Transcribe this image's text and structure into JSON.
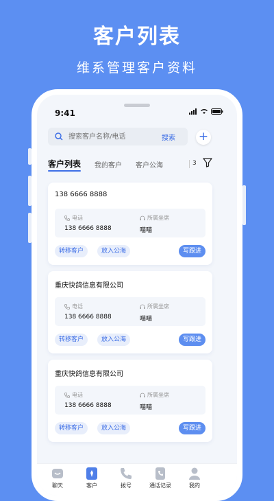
{
  "hero": {
    "title": "客户列表",
    "subtitle": "维系管理客户资料"
  },
  "status": {
    "time": "9:41"
  },
  "search": {
    "placeholder": "搜索客户名称/电话",
    "button": "搜索"
  },
  "add_label": "+",
  "tabs": [
    "客户列表",
    "我的客户",
    "客户公海"
  ],
  "tab_badge": "3",
  "labels": {
    "phone": "电话",
    "seat": "所属坐席"
  },
  "actions": {
    "transfer": "转移客户",
    "pool": "放入公海",
    "follow": "写跟进"
  },
  "cards": [
    {
      "title": "138 6666 8888",
      "phone": "138 6666 8888",
      "seat": "喵喵"
    },
    {
      "title": "重庆快鸽信息有限公司",
      "phone": "138 6666 8888",
      "seat": "喵喵"
    },
    {
      "title": "重庆快鸽信息有限公司",
      "phone": "138 6666 8888",
      "seat": "喵喵"
    }
  ],
  "nav": [
    "聊天",
    "客户",
    "拨号",
    "通话记录",
    "我的"
  ],
  "colors": {
    "background": "#5c8ff2",
    "accent": "#3e6fe6"
  }
}
